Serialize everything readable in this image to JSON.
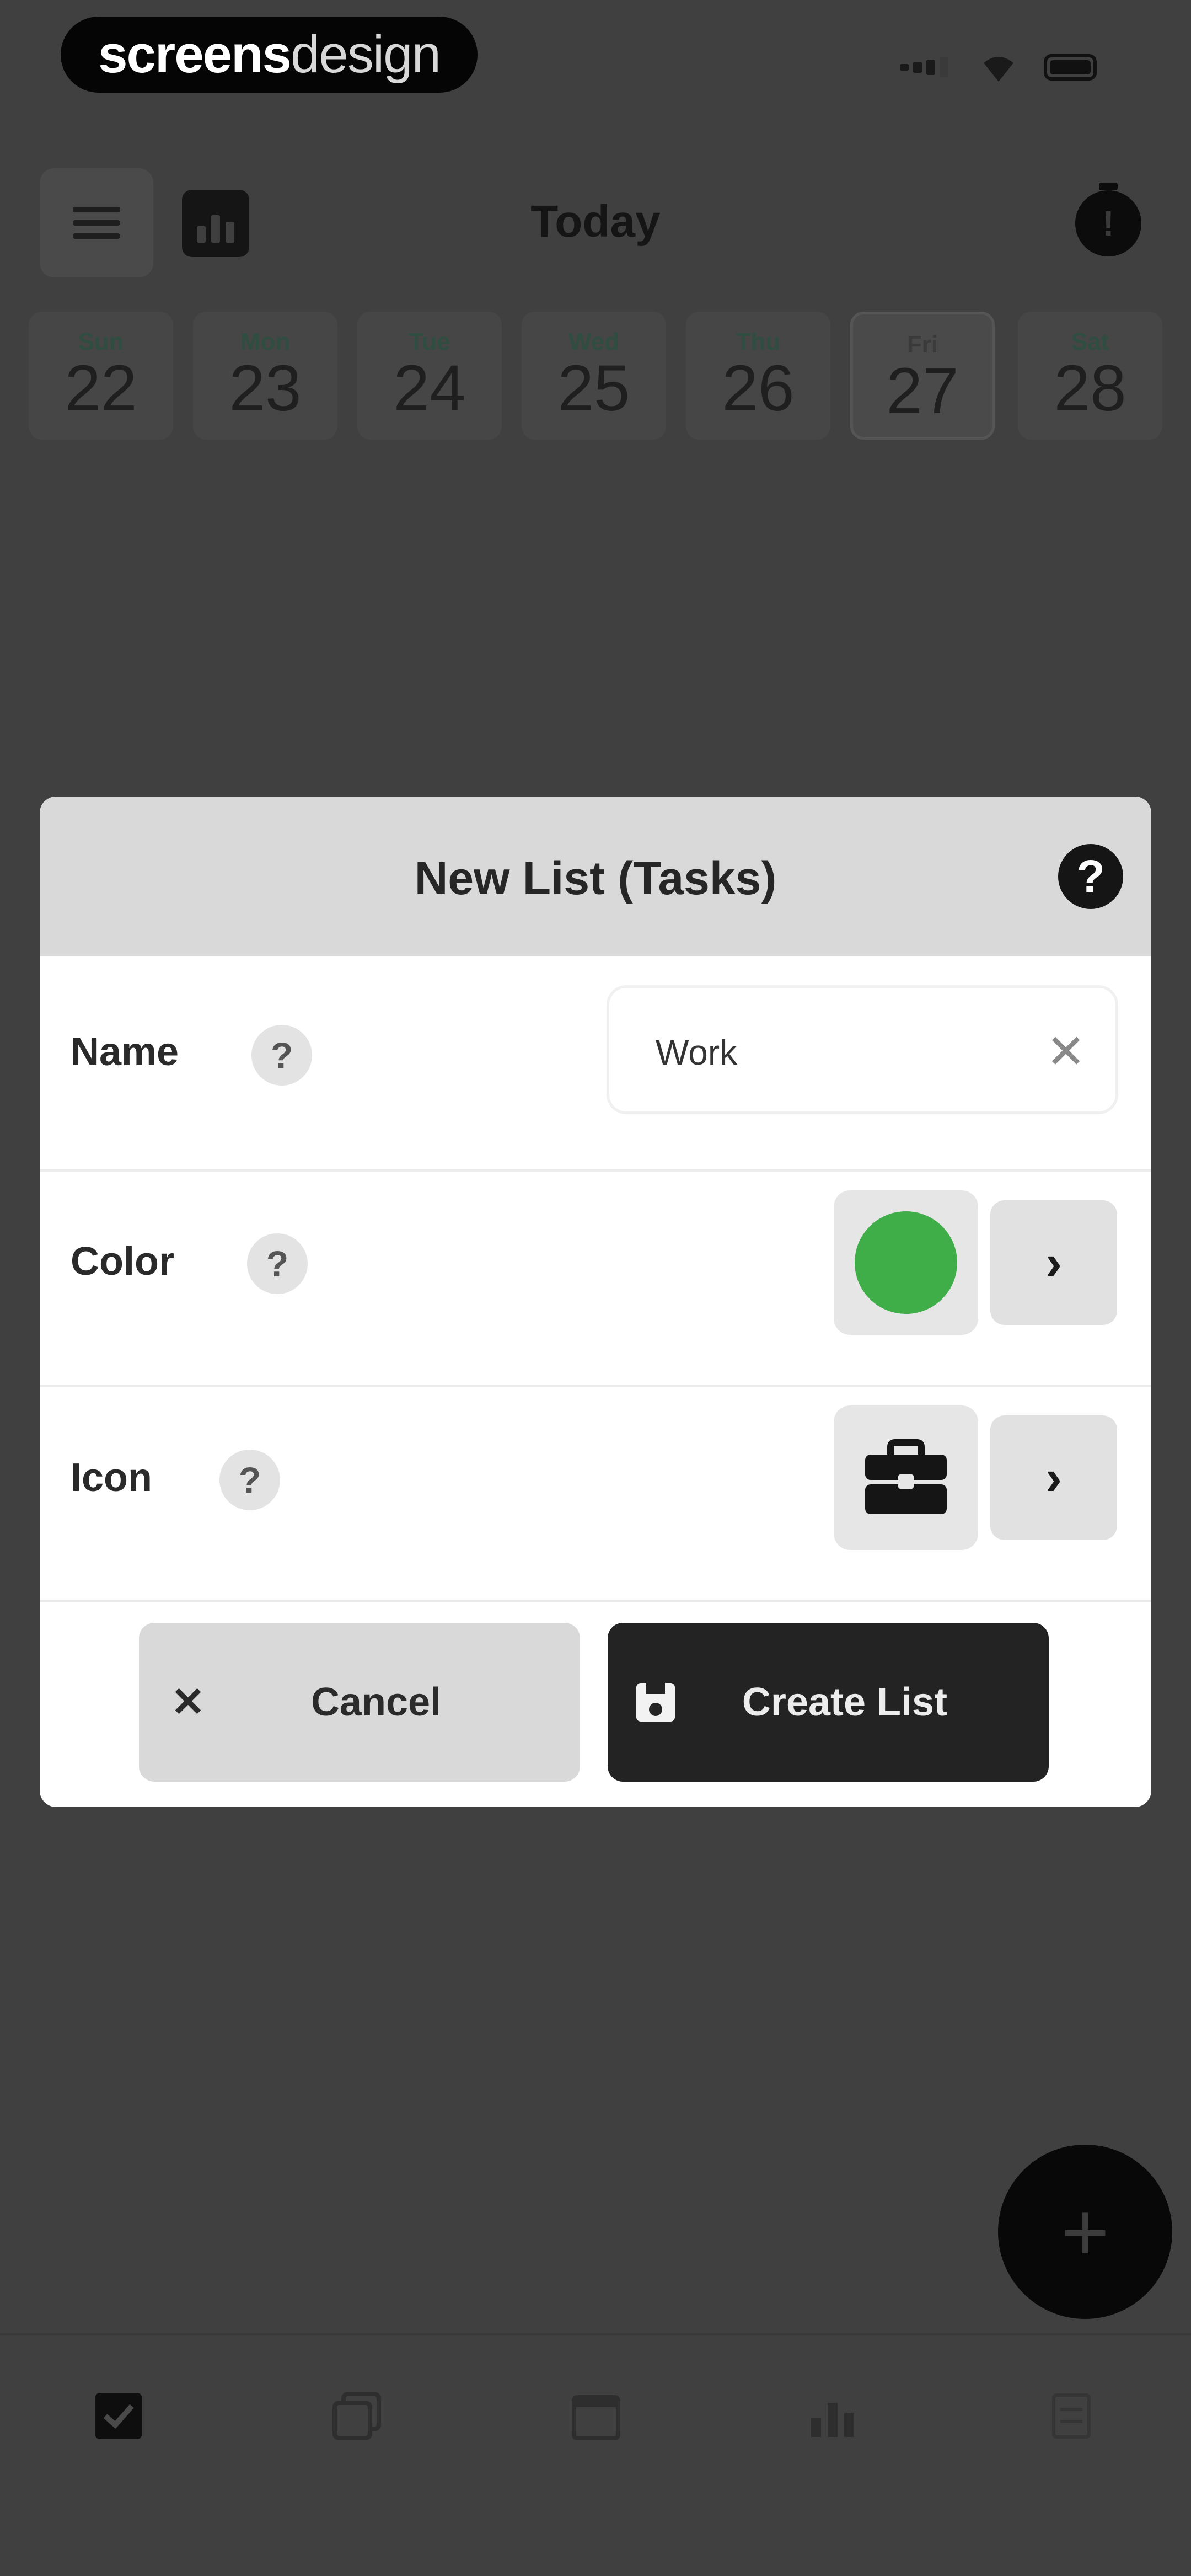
{
  "brand": {
    "bold": "screens",
    "light": "design"
  },
  "header": {
    "title": "Today"
  },
  "days": [
    {
      "dow": "Sun",
      "num": "22"
    },
    {
      "dow": "Mon",
      "num": "23"
    },
    {
      "dow": "Tue",
      "num": "24"
    },
    {
      "dow": "Wed",
      "num": "25"
    },
    {
      "dow": "Thu",
      "num": "26"
    },
    {
      "dow": "Fri",
      "num": "27"
    },
    {
      "dow": "Sat",
      "num": "28"
    }
  ],
  "modal": {
    "title": "New List (Tasks)",
    "help_glyph": "?",
    "name": {
      "label": "Name",
      "value": "Work",
      "clear_glyph": "✕"
    },
    "color": {
      "label": "Color",
      "value_hex": "#3fae49",
      "chevron": "›"
    },
    "icon": {
      "label": "Icon",
      "icon_name": "briefcase-icon",
      "chevron": "›"
    },
    "row_help_glyph": "?",
    "cancel": {
      "glyph": "✕",
      "label": "Cancel"
    },
    "create": {
      "label": "Create List",
      "icon_name": "save-icon"
    }
  },
  "fab": {
    "glyph": "+"
  },
  "bottom_nav": [
    "tasks-checkbox-icon",
    "lists-icon",
    "calendar-icon",
    "stats-icon",
    "settings-icon"
  ]
}
